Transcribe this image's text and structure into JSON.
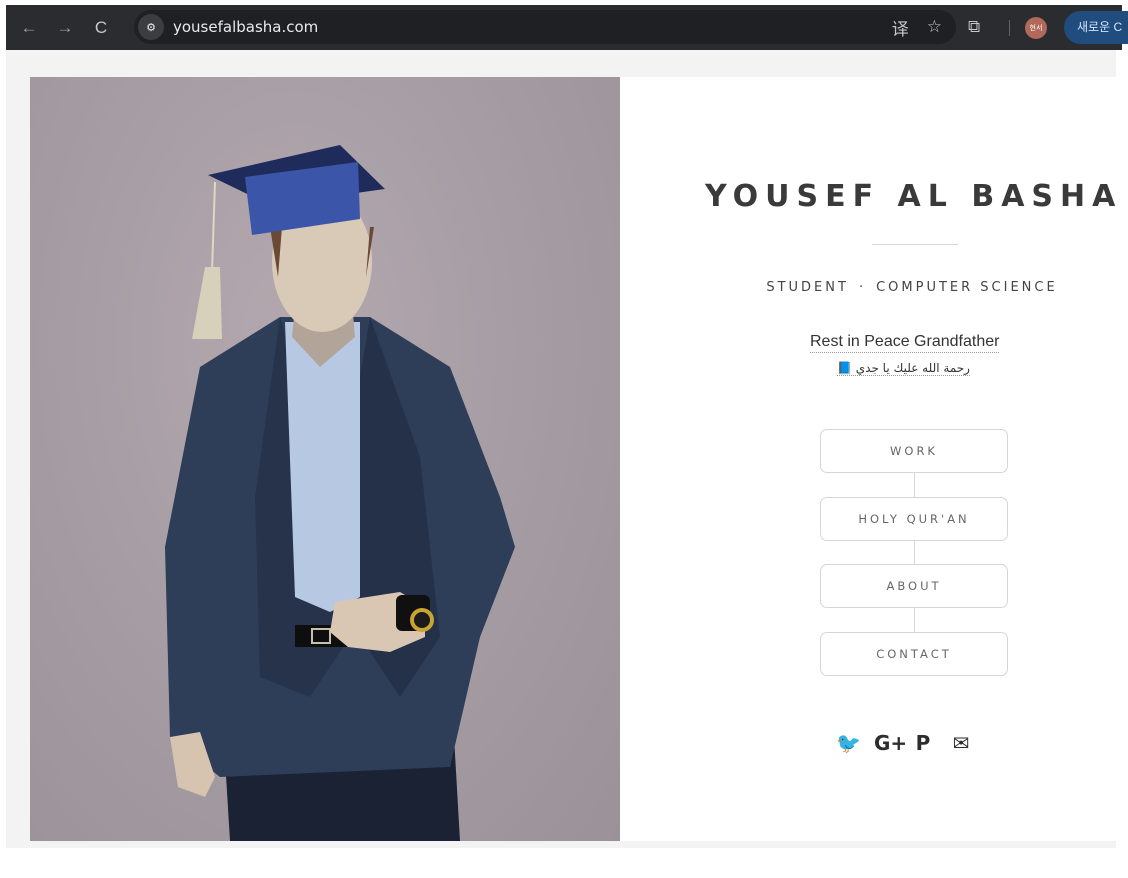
{
  "browser": {
    "back_icon": "←",
    "forward_icon": "→",
    "reload_icon": "C",
    "site_info_icon": "⚙",
    "url": "yousefalbasha.com",
    "translate_icon": "译",
    "bookmark_icon": "☆",
    "extensions_icon": "⧉",
    "profile_label": "현서",
    "new_chrome_label": "새로운 C"
  },
  "hero": {
    "name": "YOUSEF AL BASHA",
    "subtitle_left": "STUDENT",
    "subtitle_dot": "·",
    "subtitle_right": "COMPUTER SCIENCE",
    "rip_english": "Rest in Peace Grandfather",
    "rip_arabic": "رحمة الله عليك يا جدي 📘"
  },
  "menu": {
    "items": [
      {
        "label": "WORK"
      },
      {
        "label": "HOLY QUR'AN"
      },
      {
        "label": "ABOUT"
      },
      {
        "label": "CONTACT"
      }
    ]
  },
  "social": {
    "twitter": "🐦",
    "google_plus": "G+",
    "paypal": "P",
    "email": "✉"
  }
}
